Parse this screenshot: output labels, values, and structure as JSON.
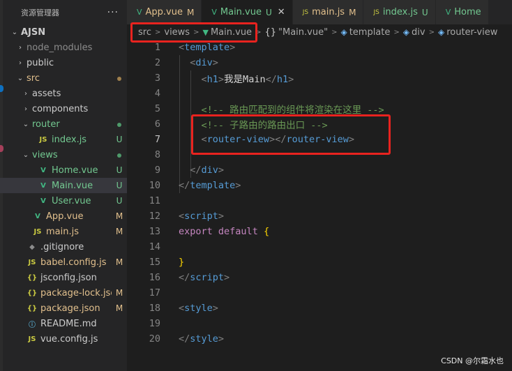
{
  "explorer": {
    "title": "资源管理器",
    "more": "···",
    "items": [
      {
        "label": "AJSN",
        "chev": "⌄",
        "indent": 0,
        "icon": "",
        "status": "",
        "color": "#cccccc",
        "bold": true
      },
      {
        "label": "node_modules",
        "chev": "›",
        "indent": 1,
        "icon": "",
        "status": "",
        "color": "#8c8c8c"
      },
      {
        "label": "public",
        "chev": "›",
        "indent": 1,
        "icon": "",
        "status": "",
        "color": "#cccccc"
      },
      {
        "label": "src",
        "chev": "⌄",
        "indent": 1,
        "icon": "",
        "status": "dot",
        "color": "#e2c08d",
        "statusColor": "#a0804c"
      },
      {
        "label": "assets",
        "chev": "›",
        "indent": 2,
        "icon": "",
        "status": "",
        "color": "#cccccc"
      },
      {
        "label": "components",
        "chev": "›",
        "indent": 2,
        "icon": "",
        "status": "",
        "color": "#cccccc"
      },
      {
        "label": "router",
        "chev": "⌄",
        "indent": 2,
        "icon": "",
        "status": "dot",
        "color": "#73c991",
        "statusColor": "#4e9a6a"
      },
      {
        "label": "index.js",
        "chev": "",
        "indent": 3,
        "icon": "JS",
        "iconClass": "js-ic",
        "status": "U",
        "color": "#73c991"
      },
      {
        "label": "views",
        "chev": "⌄",
        "indent": 2,
        "icon": "",
        "status": "dot",
        "color": "#73c991",
        "statusColor": "#4e9a6a"
      },
      {
        "label": "Home.vue",
        "chev": "",
        "indent": 3,
        "icon": "V",
        "iconClass": "vue-ic",
        "status": "U",
        "color": "#73c991"
      },
      {
        "label": "Main.vue",
        "chev": "",
        "indent": 3,
        "icon": "V",
        "iconClass": "vue-ic",
        "status": "U",
        "color": "#73c991",
        "selected": true
      },
      {
        "label": "User.vue",
        "chev": "",
        "indent": 3,
        "icon": "V",
        "iconClass": "vue-ic",
        "status": "U",
        "color": "#73c991"
      },
      {
        "label": "App.vue",
        "chev": "",
        "indent": 2,
        "icon": "V",
        "iconClass": "vue-ic",
        "status": "M",
        "color": "#e2c08d"
      },
      {
        "label": "main.js",
        "chev": "",
        "indent": 2,
        "icon": "JS",
        "iconClass": "js-ic",
        "status": "M",
        "color": "#e2c08d"
      },
      {
        "label": ".gitignore",
        "chev": "",
        "indent": 1,
        "icon": "◆",
        "iconClass": "git-ic",
        "status": "",
        "color": "#cccccc"
      },
      {
        "label": "babel.config.js",
        "chev": "",
        "indent": 1,
        "icon": "JS",
        "iconClass": "js-ic",
        "status": "M",
        "color": "#e2c08d"
      },
      {
        "label": "jsconfig.json",
        "chev": "",
        "indent": 1,
        "icon": "{}",
        "iconClass": "json-ic",
        "status": "",
        "color": "#cccccc"
      },
      {
        "label": "package-lock.json",
        "chev": "",
        "indent": 1,
        "icon": "{}",
        "iconClass": "json-ic",
        "status": "M",
        "color": "#e2c08d"
      },
      {
        "label": "package.json",
        "chev": "",
        "indent": 1,
        "icon": "{}",
        "iconClass": "json-ic",
        "status": "M",
        "color": "#e2c08d"
      },
      {
        "label": "README.md",
        "chev": "",
        "indent": 1,
        "icon": "ⓘ",
        "iconClass": "md-ic",
        "status": "",
        "color": "#cccccc"
      },
      {
        "label": "vue.config.js",
        "chev": "",
        "indent": 1,
        "icon": "JS",
        "iconClass": "js-ic",
        "status": "",
        "color": "#cccccc"
      }
    ]
  },
  "tabs": [
    {
      "label": "App.vue",
      "icon": "V",
      "iconClass": "vue-ic",
      "status": "M",
      "color": "#e2c08d"
    },
    {
      "label": "Main.vue",
      "icon": "V",
      "iconClass": "vue-ic",
      "status": "U",
      "color": "#73c991",
      "active": true,
      "close": "✕"
    },
    {
      "label": "main.js",
      "icon": "JS",
      "iconClass": "js-ic",
      "status": "M",
      "color": "#e2c08d"
    },
    {
      "label": "index.js",
      "icon": "JS",
      "iconClass": "js-ic",
      "status": "U",
      "color": "#73c991"
    },
    {
      "label": "Home",
      "icon": "V",
      "iconClass": "vue-ic",
      "status": "",
      "color": "#73c991"
    }
  ],
  "breadcrumb": {
    "src": "src",
    "views": "views",
    "file": "Main.vue",
    "curly": "{}",
    "component": "\"Main.vue\"",
    "template": "template",
    "div": "div",
    "router_view": "router-view",
    "sep": ">"
  },
  "code_lines": [
    {
      "n": "1",
      "tokens": [
        [
          "tg",
          "<"
        ],
        [
          "tn",
          "template"
        ],
        [
          "tg",
          ">"
        ]
      ]
    },
    {
      "n": "2",
      "tokens": [
        [
          "",
          "  "
        ],
        [
          "tg",
          "<"
        ],
        [
          "tn",
          "div"
        ],
        [
          "tg",
          ">"
        ]
      ]
    },
    {
      "n": "3",
      "tokens": [
        [
          "",
          "    "
        ],
        [
          "tg",
          "<"
        ],
        [
          "tn",
          "h1"
        ],
        [
          "tg",
          ">"
        ],
        [
          "",
          "我是Main"
        ],
        [
          "tg",
          "</"
        ],
        [
          "tn",
          "h1"
        ],
        [
          "tg",
          ">"
        ]
      ]
    },
    {
      "n": "4",
      "tokens": []
    },
    {
      "n": "5",
      "tokens": [
        [
          "",
          "    "
        ],
        [
          "cm",
          "<!-- 路由匹配到的组件将渲染在这里 -->"
        ]
      ]
    },
    {
      "n": "6",
      "tokens": [
        [
          "",
          "    "
        ],
        [
          "cm",
          "<!-- 子路由的路由出口 -->"
        ]
      ]
    },
    {
      "n": "7",
      "tokens": [
        [
          "",
          "    "
        ],
        [
          "tg",
          "<"
        ],
        [
          "tn",
          "router-view"
        ],
        [
          "tg",
          ">"
        ],
        [
          "tg",
          "</"
        ],
        [
          "tn",
          "router-view"
        ],
        [
          "tg",
          ">"
        ]
      ],
      "current": true
    },
    {
      "n": "8",
      "tokens": []
    },
    {
      "n": "9",
      "tokens": [
        [
          "",
          "  "
        ],
        [
          "tg",
          "</"
        ],
        [
          "tn",
          "div"
        ],
        [
          "tg",
          ">"
        ]
      ]
    },
    {
      "n": "10",
      "tokens": [
        [
          "tg",
          "</"
        ],
        [
          "tn",
          "template"
        ],
        [
          "tg",
          ">"
        ]
      ]
    },
    {
      "n": "11",
      "tokens": []
    },
    {
      "n": "12",
      "tokens": [
        [
          "tg",
          "<"
        ],
        [
          "tn",
          "script"
        ],
        [
          "tg",
          ">"
        ]
      ]
    },
    {
      "n": "13",
      "tokens": [
        [
          "kw",
          "export"
        ],
        [
          "",
          " "
        ],
        [
          "kw",
          "default"
        ],
        [
          "",
          " "
        ],
        [
          "br",
          "{"
        ]
      ]
    },
    {
      "n": "14",
      "tokens": []
    },
    {
      "n": "15",
      "tokens": [
        [
          "br",
          "}"
        ]
      ]
    },
    {
      "n": "16",
      "tokens": [
        [
          "tg",
          "</"
        ],
        [
          "tn",
          "script"
        ],
        [
          "tg",
          ">"
        ]
      ]
    },
    {
      "n": "17",
      "tokens": []
    },
    {
      "n": "18",
      "tokens": [
        [
          "tg",
          "<"
        ],
        [
          "tn",
          "style"
        ],
        [
          "tg",
          ">"
        ]
      ]
    },
    {
      "n": "19",
      "tokens": []
    },
    {
      "n": "20",
      "tokens": [
        [
          "tg",
          "</"
        ],
        [
          "tn",
          "style"
        ],
        [
          "tg",
          ">"
        ]
      ]
    }
  ],
  "watermark": "CSDN @尔霜水也",
  "colors": {
    "highlight_box": "#e8231f",
    "vue_green": "#41b883",
    "untracked": "#73c991",
    "modified": "#e2c08d"
  }
}
